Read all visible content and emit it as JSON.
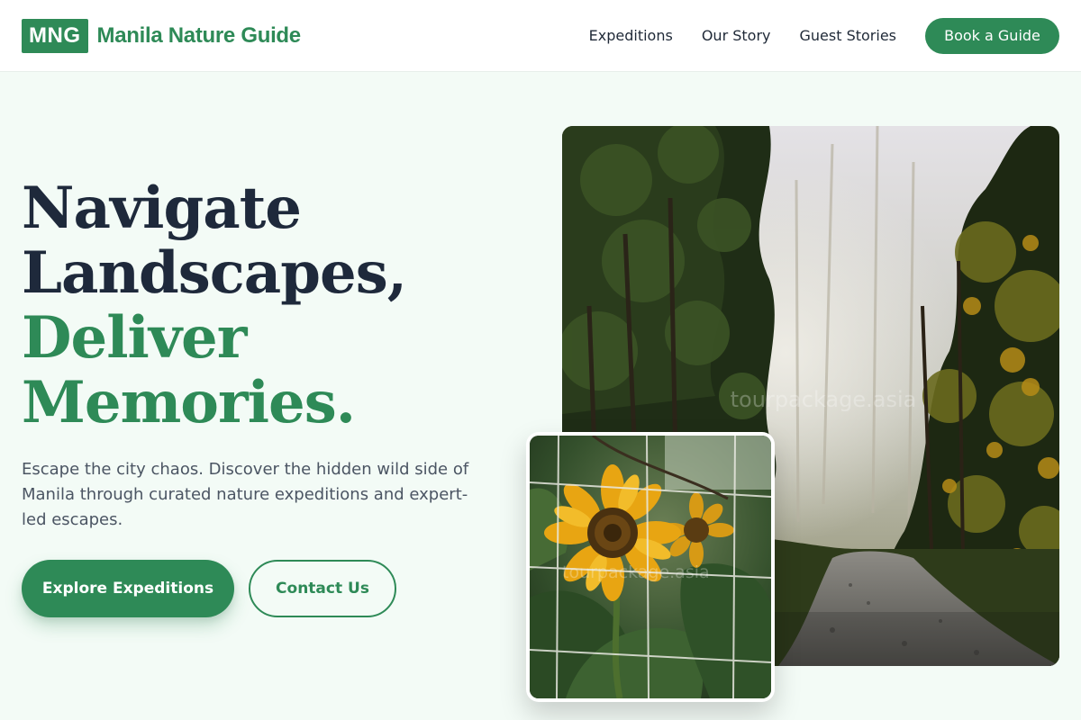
{
  "brand": {
    "logo_text": "MNG",
    "name": "Manila Nature Guide"
  },
  "nav": {
    "links": [
      "Expeditions",
      "Our Story",
      "Guest Stories"
    ],
    "cta": "Book a Guide"
  },
  "hero": {
    "title_line1": "Navigate",
    "title_line2": "Landscapes,",
    "title_line3": "Deliver",
    "title_line4": "Memories.",
    "description": "Escape the city chaos. Discover the hidden wild side of Manila through curated nature expeditions and expert-led escapes.",
    "primary_button": "Explore Expeditions",
    "secondary_button": "Contact Us"
  },
  "images": {
    "forest_watermark": "tourpackage.asia",
    "sunflower_watermark": "tourpackage.asia"
  },
  "colors": {
    "brand_green": "#2e8a57",
    "heading_dark": "#1e293b",
    "page_background": "#f3fbf6"
  }
}
